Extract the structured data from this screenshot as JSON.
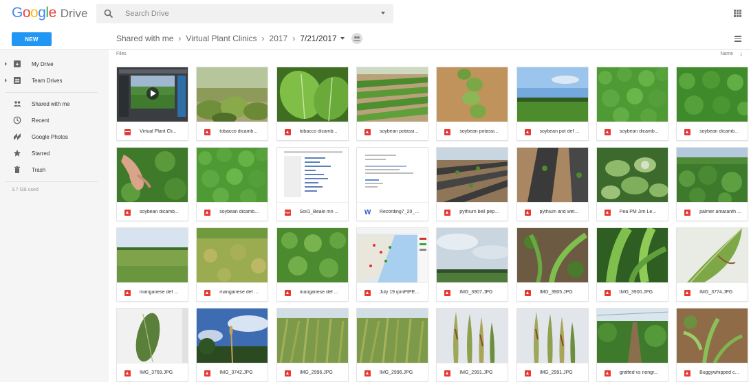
{
  "app": {
    "logo_text": "Google",
    "product": "Drive"
  },
  "search": {
    "placeholder": "Search Drive"
  },
  "toolbar": {
    "new_label": "NEW",
    "breadcrumb": [
      "Shared with me",
      "Virtual Plant Clinics",
      "2017",
      "7/21/2017"
    ]
  },
  "sidebar": {
    "items": [
      {
        "label": "My Drive",
        "icon": "my-drive-icon"
      },
      {
        "label": "Team Drives",
        "icon": "team-drives-icon"
      },
      {
        "label": "Shared with me",
        "icon": "shared-icon"
      },
      {
        "label": "Recent",
        "icon": "clock-icon"
      },
      {
        "label": "Google Photos",
        "icon": "photos-icon"
      },
      {
        "label": "Starred",
        "icon": "star-icon"
      },
      {
        "label": "Trash",
        "icon": "trash-icon"
      }
    ],
    "storage": "3.7 GB used"
  },
  "main": {
    "section_label": "Files",
    "sort_label": "Name"
  },
  "files": [
    {
      "name": "Virtual Plant Cli...",
      "type": "video",
      "thumb": "video"
    },
    {
      "name": "tobacco dicamb...",
      "type": "image",
      "thumb": "tobacco1"
    },
    {
      "name": "tobacco dicamb...",
      "type": "image",
      "thumb": "tobacco2"
    },
    {
      "name": "soybean potassi...",
      "type": "image",
      "thumb": "rows"
    },
    {
      "name": "soybean potassi...",
      "type": "image",
      "thumb": "soil-plant"
    },
    {
      "name": "soybean pot def ...",
      "type": "image",
      "thumb": "sky-field"
    },
    {
      "name": "soybean dicamb...",
      "type": "image",
      "thumb": "dense-green"
    },
    {
      "name": "soybean dicamb...",
      "type": "image",
      "thumb": "dense-green2"
    },
    {
      "name": "soybean dicamb...",
      "type": "image",
      "thumb": "hand"
    },
    {
      "name": "soybean dicamb...",
      "type": "image",
      "thumb": "dense-green"
    },
    {
      "name": "Soil1_Beale mn ...",
      "type": "pdf",
      "thumb": "document"
    },
    {
      "name": "Recording7_20_...",
      "type": "word",
      "thumb": "letter"
    },
    {
      "name": "pythium bell pep...",
      "type": "image",
      "thumb": "plastic-rows"
    },
    {
      "name": "pythium and wet...",
      "type": "image",
      "thumb": "plastic-brown"
    },
    {
      "name": "Pea PM Jim Le...",
      "type": "image",
      "thumb": "pea"
    },
    {
      "name": "palmer amaranth ...",
      "type": "image",
      "thumb": "weeds"
    },
    {
      "name": "manganese def ...",
      "type": "image",
      "thumb": "horizon"
    },
    {
      "name": "manganese def ...",
      "type": "image",
      "thumb": "yellowfield"
    },
    {
      "name": "manganese def ...",
      "type": "image",
      "thumb": "leafy"
    },
    {
      "name": "July 19 ipmPIPE...",
      "type": "image",
      "thumb": "map"
    },
    {
      "name": "IMG_3907.JPG",
      "type": "image",
      "thumb": "cloudy"
    },
    {
      "name": "IMG_3905.JPG",
      "type": "image",
      "thumb": "corn-ground"
    },
    {
      "name": "IMG_3900.JPG",
      "type": "image",
      "thumb": "corn-close"
    },
    {
      "name": "IMG_3774.JPG",
      "type": "image",
      "thumb": "leaf-white"
    },
    {
      "name": "IMG_3769.JPG",
      "type": "image",
      "thumb": "single-leaf"
    },
    {
      "name": "IMG_3742.JPG",
      "type": "image",
      "thumb": "wheat-sky"
    },
    {
      "name": "IMG_2996.JPG",
      "type": "image",
      "thumb": "wheat"
    },
    {
      "name": "IMG_2996.JPG",
      "type": "image",
      "thumb": "wheat"
    },
    {
      "name": "IMG_2991.JPG",
      "type": "image",
      "thumb": "blades"
    },
    {
      "name": "IMG_2991.JPG",
      "type": "image",
      "thumb": "blades"
    },
    {
      "name": "grafted vs nongr...",
      "type": "image",
      "thumb": "greenhouse"
    },
    {
      "name": "Buggywhipped c...",
      "type": "image",
      "thumb": "buggy"
    }
  ],
  "colors": {
    "accent": "#2196f3",
    "file_icon_red": "#e53935",
    "sidebar_bg": "#f5f5f5"
  }
}
